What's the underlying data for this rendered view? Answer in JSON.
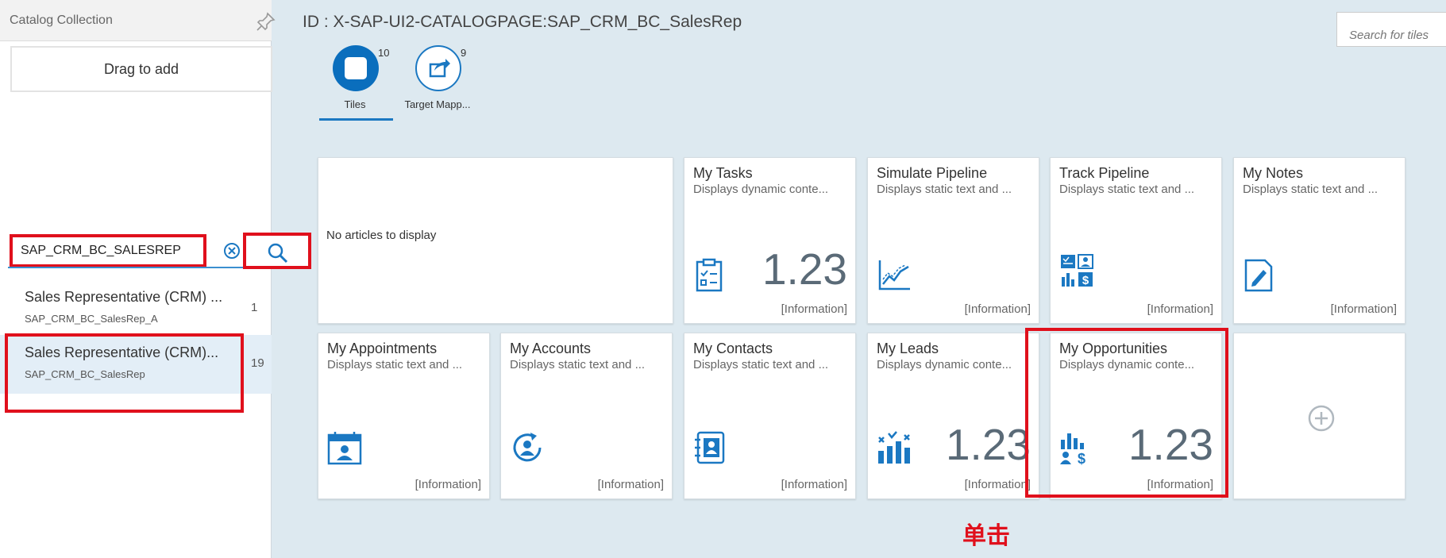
{
  "sidebar": {
    "title": "Catalog Collection",
    "drag_label": "Drag to add",
    "search_value": "SAP_CRM_BC_SALESREP",
    "items": [
      {
        "title": "Sales Representative (CRM) ...",
        "subtitle": "SAP_CRM_BC_SalesRep_A",
        "count": "1"
      },
      {
        "title": "Sales Representative (CRM)...",
        "subtitle": "SAP_CRM_BC_SalesRep",
        "count": "19"
      }
    ]
  },
  "main": {
    "page_title": "ID : X-SAP-UI2-CATALOGPAGE:SAP_CRM_BC_SalesRep",
    "search_placeholder": "Search for tiles",
    "tabs": [
      {
        "label": "Tiles",
        "count": "10",
        "icon": "tile-square-icon"
      },
      {
        "label": "Target Mapp...",
        "count": "9",
        "icon": "share-arrow-icon"
      }
    ],
    "news_tile": {
      "text": "No articles to display"
    },
    "tiles": [
      {
        "title": "My Tasks",
        "subtitle": "Displays dynamic conte...",
        "number": "1.23",
        "info": "[Information]",
        "icon": "task-clipboard-icon"
      },
      {
        "title": "Simulate Pipeline",
        "subtitle": "Displays static text and ...",
        "number": "",
        "info": "[Information]",
        "icon": "line-chart-icon"
      },
      {
        "title": "Track Pipeline",
        "subtitle": "Displays static text and ...",
        "number": "",
        "info": "[Information]",
        "icon": "pipeline-grid-icon"
      },
      {
        "title": "My Notes",
        "subtitle": "Displays static text and ...",
        "number": "",
        "info": "[Information]",
        "icon": "note-pencil-icon"
      },
      {
        "title": "My Appointments",
        "subtitle": "Displays static text and ...",
        "number": "",
        "info": "[Information]",
        "icon": "calendar-person-icon"
      },
      {
        "title": "My Accounts",
        "subtitle": "Displays static text and ...",
        "number": "",
        "info": "[Information]",
        "icon": "account-refresh-icon"
      },
      {
        "title": "My Contacts",
        "subtitle": "Displays static text and ...",
        "number": "",
        "info": "[Information]",
        "icon": "contact-book-icon"
      },
      {
        "title": "My Leads",
        "subtitle": "Displays dynamic conte...",
        "number": "1.23",
        "info": "[Information]",
        "icon": "leads-chart-icon"
      },
      {
        "title": "My Opportunities",
        "subtitle": "Displays dynamic conte...",
        "number": "1.23",
        "info": "[Information]",
        "icon": "opportunity-chart-icon"
      }
    ],
    "annotation": "单击"
  },
  "colors": {
    "accent": "#0a6ebd",
    "highlight": "#e0101c",
    "background": "#dde9f0"
  }
}
